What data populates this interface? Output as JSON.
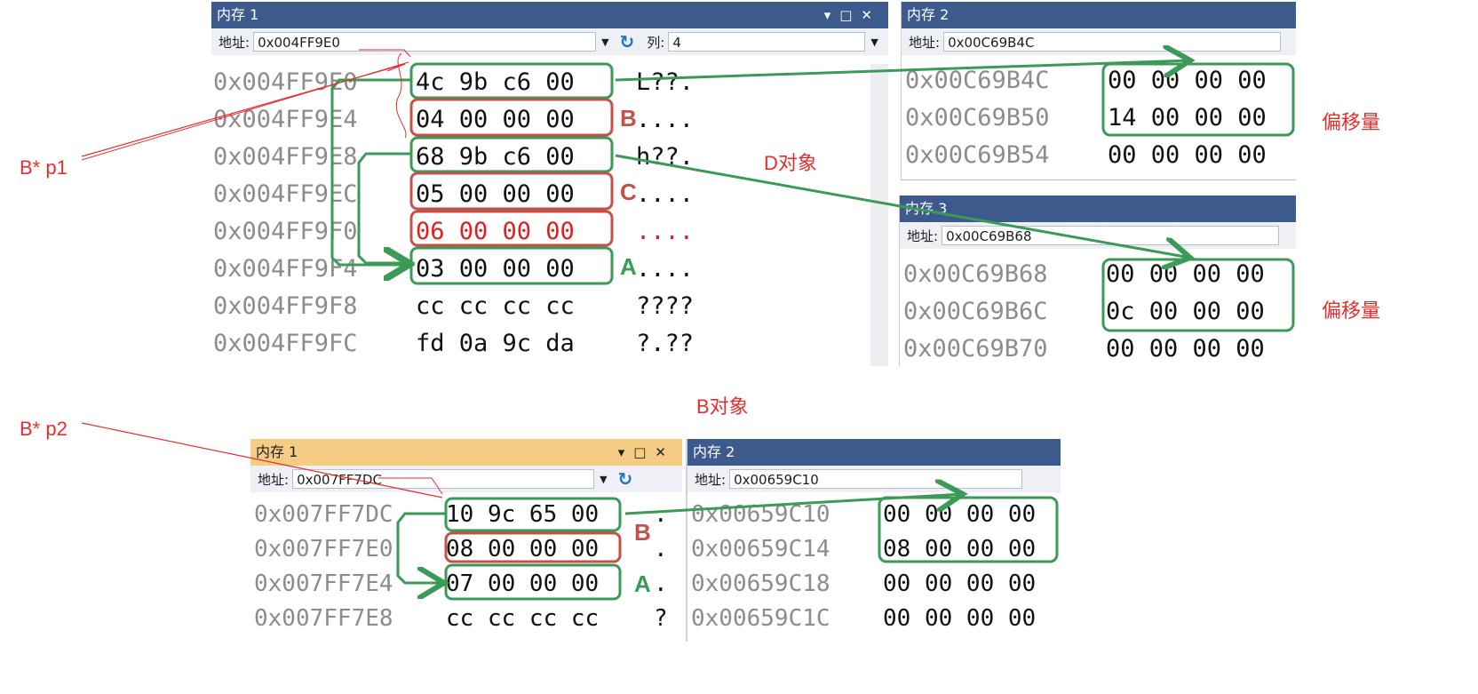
{
  "colors": {
    "title_bar": "#3d5a8c",
    "title_bar_active": "#f5cc84",
    "annotation_red": "#e62e2e",
    "box_green": "#3b9a57",
    "box_red": "#c4504a"
  },
  "annotations": {
    "p1": "B* p1",
    "p2": "B* p2",
    "d_object": "D对象",
    "b_object": "B对象",
    "offset1": "偏移量",
    "offset2": "偏移量"
  },
  "tags": {
    "b1": "B",
    "c1": "C",
    "a1": "A",
    "b2": "B",
    "a2": "A"
  },
  "top_mem1": {
    "title": "内存 1",
    "address_label": "地址:",
    "address": "0x004FF9E0",
    "column_label": "列:",
    "column_value": "4",
    "rows": [
      {
        "addr": "0x004FF9E0",
        "bytes": "4c 9b c6 00",
        "ascii": "L??."
      },
      {
        "addr": "0x004FF9E4",
        "bytes": "04 00 00 00",
        "ascii": "...."
      },
      {
        "addr": "0x004FF9E8",
        "bytes": "68 9b c6 00",
        "ascii": "h??."
      },
      {
        "addr": "0x004FF9EC",
        "bytes": "05 00 00 00",
        "ascii": "...."
      },
      {
        "addr": "0x004FF9F0",
        "bytes": "06 00 00 00",
        "ascii": "...."
      },
      {
        "addr": "0x004FF9F4",
        "bytes": "03 00 00 00",
        "ascii": "...."
      },
      {
        "addr": "0x004FF9F8",
        "bytes": "cc cc cc cc",
        "ascii": "????"
      },
      {
        "addr": "0x004FF9FC",
        "bytes": "fd 0a 9c da",
        "ascii": "?.??"
      }
    ]
  },
  "top_mem2": {
    "title": "内存 2",
    "address_label": "地址:",
    "address": "0x00C69B4C",
    "rows": [
      {
        "addr": "0x00C69B4C",
        "bytes": "00 00 00 00"
      },
      {
        "addr": "0x00C69B50",
        "bytes": "14 00 00 00"
      },
      {
        "addr": "0x00C69B54",
        "bytes": "00 00 00 00"
      }
    ]
  },
  "top_mem3": {
    "title": "内存 3",
    "address_label": "地址:",
    "address": "0x00C69B68",
    "rows": [
      {
        "addr": "0x00C69B68",
        "bytes": "00 00 00 00"
      },
      {
        "addr": "0x00C69B6C",
        "bytes": "0c 00 00 00"
      },
      {
        "addr": "0x00C69B70",
        "bytes": "00 00 00 00"
      }
    ]
  },
  "bot_mem1": {
    "title": "内存 1",
    "address_label": "地址:",
    "address": "0x007FF7DC",
    "rows": [
      {
        "addr": "0x007FF7DC",
        "bytes": "10 9c 65 00",
        "ascii": "."
      },
      {
        "addr": "0x007FF7E0",
        "bytes": "08 00 00 00",
        "ascii": "."
      },
      {
        "addr": "0x007FF7E4",
        "bytes": "07 00 00 00",
        "ascii": "."
      },
      {
        "addr": "0x007FF7E8",
        "bytes": "cc cc cc cc",
        "ascii": "?"
      }
    ]
  },
  "bot_mem2": {
    "title": "内存 2",
    "address_label": "地址:",
    "address": "0x00659C10",
    "rows": [
      {
        "addr": "0x00659C10",
        "bytes": "00 00 00 00"
      },
      {
        "addr": "0x00659C14",
        "bytes": "08 00 00 00"
      },
      {
        "addr": "0x00659C18",
        "bytes": "00 00 00 00"
      },
      {
        "addr": "0x00659C1C",
        "bytes": "00 00 00 00"
      }
    ]
  }
}
